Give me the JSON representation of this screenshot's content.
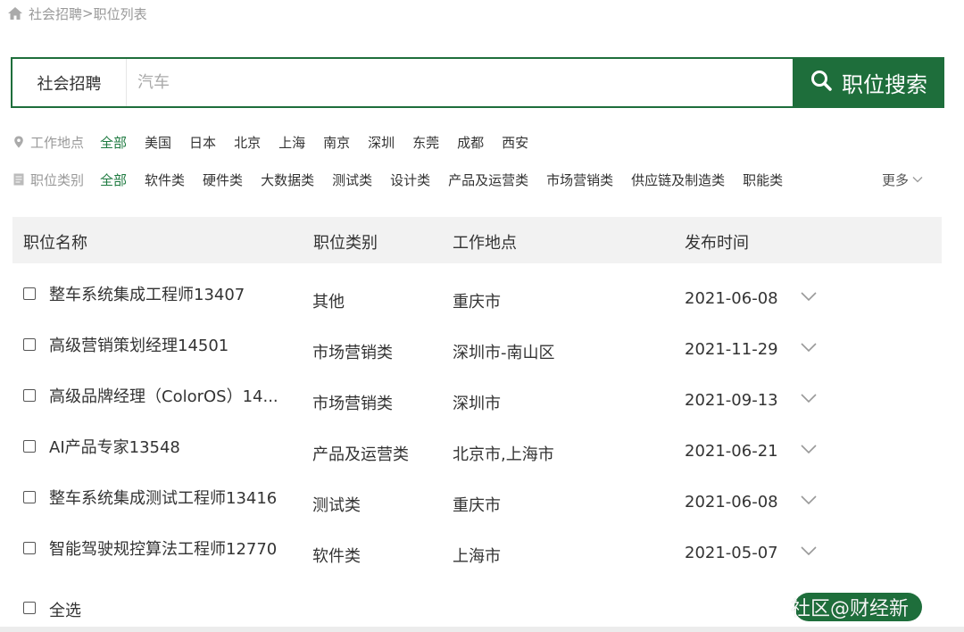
{
  "breadcrumb": {
    "root": "社会招聘",
    "separator": ">",
    "current": "职位列表"
  },
  "search": {
    "type_label": "社会招聘",
    "placeholder": "汽车",
    "button_label": "职位搜索"
  },
  "filters": {
    "location": {
      "label": "工作地点",
      "options": [
        "全部",
        "美国",
        "日本",
        "北京",
        "上海",
        "南京",
        "深圳",
        "东莞",
        "成都",
        "西安"
      ],
      "selected": "全部"
    },
    "category": {
      "label": "职位类别",
      "options": [
        "全部",
        "软件类",
        "硬件类",
        "大数据类",
        "测试类",
        "设计类",
        "产品及运营类",
        "市场营销类",
        "供应链及制造类",
        "职能类"
      ],
      "selected": "全部",
      "more_label": "更多"
    }
  },
  "table": {
    "headers": [
      "职位名称",
      "职位类别",
      "工作地点",
      "发布时间"
    ],
    "rows": [
      {
        "title": "整车系统集成工程师13407",
        "category": "其他",
        "location": "重庆市",
        "date": "2021-06-08"
      },
      {
        "title": "高级营销策划经理14501",
        "category": "市场营销类",
        "location": "深圳市-南山区",
        "date": "2021-11-29"
      },
      {
        "title": "高级品牌经理（ColorOS）14...",
        "category": "市场营销类",
        "location": "深圳市",
        "date": "2021-09-13"
      },
      {
        "title": "AI产品专家13548",
        "category": "产品及运营类",
        "location": "北京市,上海市",
        "date": "2021-06-21"
      },
      {
        "title": "整车系统集成测试工程师13416",
        "category": "测试类",
        "location": "重庆市",
        "date": "2021-06-08"
      },
      {
        "title": "智能驾驶规控算法工程师12770",
        "category": "软件类",
        "location": "上海市",
        "date": "2021-05-07"
      }
    ]
  },
  "footer": {
    "select_all_label": "全选",
    "watermark": "社区@财经新"
  },
  "colors": {
    "accent": "#1e6e3b",
    "active_filter": "#1e7a40",
    "header_bg": "#f2f2f2"
  },
  "icons": {
    "breadcrumb": "home-icon",
    "location_filter": "map-pin-icon",
    "category_filter": "document-icon",
    "search_button": "search-icon",
    "row_expand": "chevron-down-icon"
  }
}
